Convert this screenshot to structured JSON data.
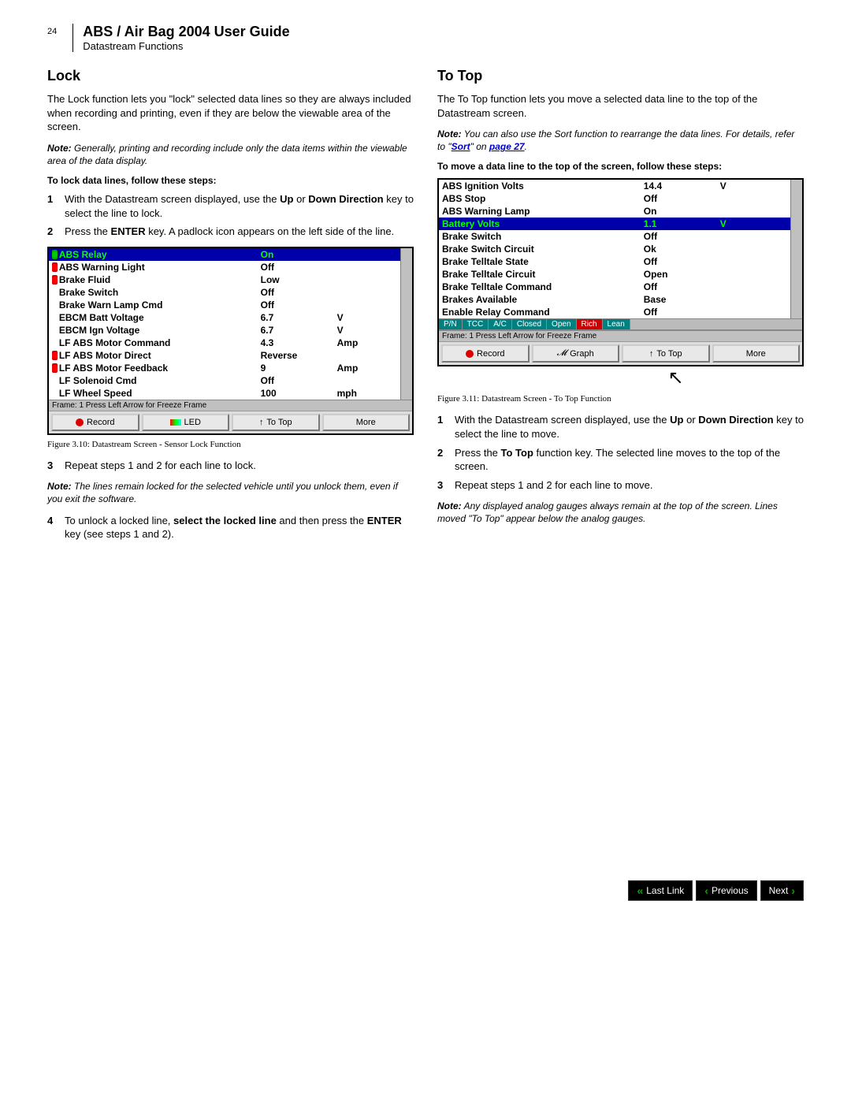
{
  "page_number": "24",
  "doc_title": "ABS / Air Bag 2004 User Guide",
  "doc_subtitle": "Datastream Functions",
  "lock": {
    "heading": "Lock",
    "intro": "The Lock function lets you \"lock\" selected data lines so they are always included when recording and printing, even if they are below the viewable area of the screen.",
    "note_label": "Note:",
    "note_text": "Generally, printing and recording include only the data items within the viewable area of the data display.",
    "steps_intro": "To lock data lines, follow these steps:",
    "steps": [
      {
        "num": "1",
        "parts": [
          "With the Datastream screen displayed, use the ",
          "Up",
          " or ",
          "Down Direction",
          " key to select the line to lock."
        ]
      },
      {
        "num": "2",
        "parts": [
          "Press the ",
          "ENTER",
          " key. A padlock icon appears on the left side of the line."
        ]
      }
    ],
    "steps2": [
      {
        "num": "3",
        "parts": [
          "Repeat steps 1 and 2 for each line to lock."
        ]
      }
    ],
    "note2_label": "Note:",
    "note2_text": "The lines remain locked for the selected vehicle until you unlock them, even if you exit the software.",
    "steps3": [
      {
        "num": "4",
        "parts": [
          "To unlock a locked line, ",
          "select the locked line",
          " and then press the ",
          "ENTER",
          " key (see steps 1 and 2)."
        ]
      }
    ],
    "fig_caption": "Figure 3.10: Datastream Screen - Sensor Lock Function"
  },
  "totop": {
    "heading": "To Top",
    "intro": "The To Top function lets you move a selected data line to the top of the Datastream screen.",
    "note_label": "Note:",
    "note_pre": "You can also use the Sort function to rearrange the data lines. For details, refer to \"",
    "note_link": "Sort",
    "note_mid": "\" on ",
    "note_link2": "page 27",
    "note_post": ".",
    "steps_intro": "To move a data line to the top of the screen, follow these steps:",
    "fig_caption": "Figure 3.11: Datastream Screen - To Top Function",
    "steps": [
      {
        "num": "1",
        "parts": [
          "With the Datastream screen displayed, use the ",
          "Up",
          " or ",
          "Down Direction",
          " key to select the line to move."
        ]
      },
      {
        "num": "2",
        "parts": [
          "Press the ",
          "To Top",
          " function key. The selected line moves to the top of the screen."
        ]
      },
      {
        "num": "3",
        "parts": [
          "Repeat steps 1 and 2 for each line to move."
        ]
      }
    ],
    "note2_label": "Note:",
    "note2_text": "Any displayed analog gauges always remain at the top of the screen. Lines moved \"To Top\" appear below the analog gauges."
  },
  "screen1": {
    "rows": [
      {
        "lock": "green",
        "name": "ABS Relay",
        "val": "On",
        "unit": "",
        "hilite": true
      },
      {
        "lock": "red",
        "name": "ABS Warning Light",
        "val": "Off",
        "unit": ""
      },
      {
        "lock": "red",
        "name": "Brake Fluid",
        "val": "Low",
        "unit": ""
      },
      {
        "lock": "",
        "name": "Brake Switch",
        "val": "Off",
        "unit": ""
      },
      {
        "lock": "",
        "name": "Brake Warn Lamp Cmd",
        "val": "Off",
        "unit": ""
      },
      {
        "lock": "",
        "name": "EBCM Batt Voltage",
        "val": "6.7",
        "unit": "V"
      },
      {
        "lock": "",
        "name": "EBCM Ign Voltage",
        "val": "6.7",
        "unit": "V"
      },
      {
        "lock": "",
        "name": "LF ABS Motor Command",
        "val": "4.3",
        "unit": "Amp"
      },
      {
        "lock": "red",
        "name": "LF ABS Motor Direct",
        "val": "Reverse",
        "unit": ""
      },
      {
        "lock": "red",
        "name": "LF ABS Motor Feedback",
        "val": "9",
        "unit": "Amp"
      },
      {
        "lock": "",
        "name": "LF Solenoid Cmd",
        "val": "Off",
        "unit": ""
      },
      {
        "lock": "",
        "name": "LF Wheel Speed",
        "val": "100",
        "unit": "mph"
      }
    ],
    "frame_line": "Frame: 1        Press Left Arrow for Freeze Frame",
    "buttons": {
      "record": "Record",
      "led": "LED",
      "totop": "To Top",
      "more": "More"
    }
  },
  "screen2": {
    "rows": [
      {
        "name": "ABS Ignition Volts",
        "val": "14.4",
        "unit": "V"
      },
      {
        "name": "ABS Stop",
        "val": "Off",
        "unit": ""
      },
      {
        "name": "ABS Warning Lamp",
        "val": "On",
        "unit": ""
      },
      {
        "name": "Battery Volts",
        "val": "1.1",
        "unit": "V",
        "hilite": true
      },
      {
        "name": "Brake Switch",
        "val": "Off",
        "unit": ""
      },
      {
        "name": "Brake Switch Circuit",
        "val": "Ok",
        "unit": ""
      },
      {
        "name": "Brake Telltale State",
        "val": "Off",
        "unit": ""
      },
      {
        "name": "Brake Telltale Circuit",
        "val": "Open",
        "unit": ""
      },
      {
        "name": "Brake Telltale Command",
        "val": "Off",
        "unit": ""
      },
      {
        "name": "Brakes Available",
        "val": "Base",
        "unit": ""
      },
      {
        "name": "Enable Relay Command",
        "val": "Off",
        "unit": ""
      }
    ],
    "tabs": [
      "P/N",
      "TCC",
      "A/C",
      "Closed",
      "Open",
      "Rich",
      "Lean"
    ],
    "frame_line": "Frame: 1                     Press Left Arrow for Freeze Frame",
    "buttons": {
      "record": "Record",
      "graph": "Graph",
      "totop": "To Top",
      "more": "More"
    }
  },
  "footer": {
    "lastlink": "Last Link",
    "previous": "Previous",
    "next": "Next"
  }
}
